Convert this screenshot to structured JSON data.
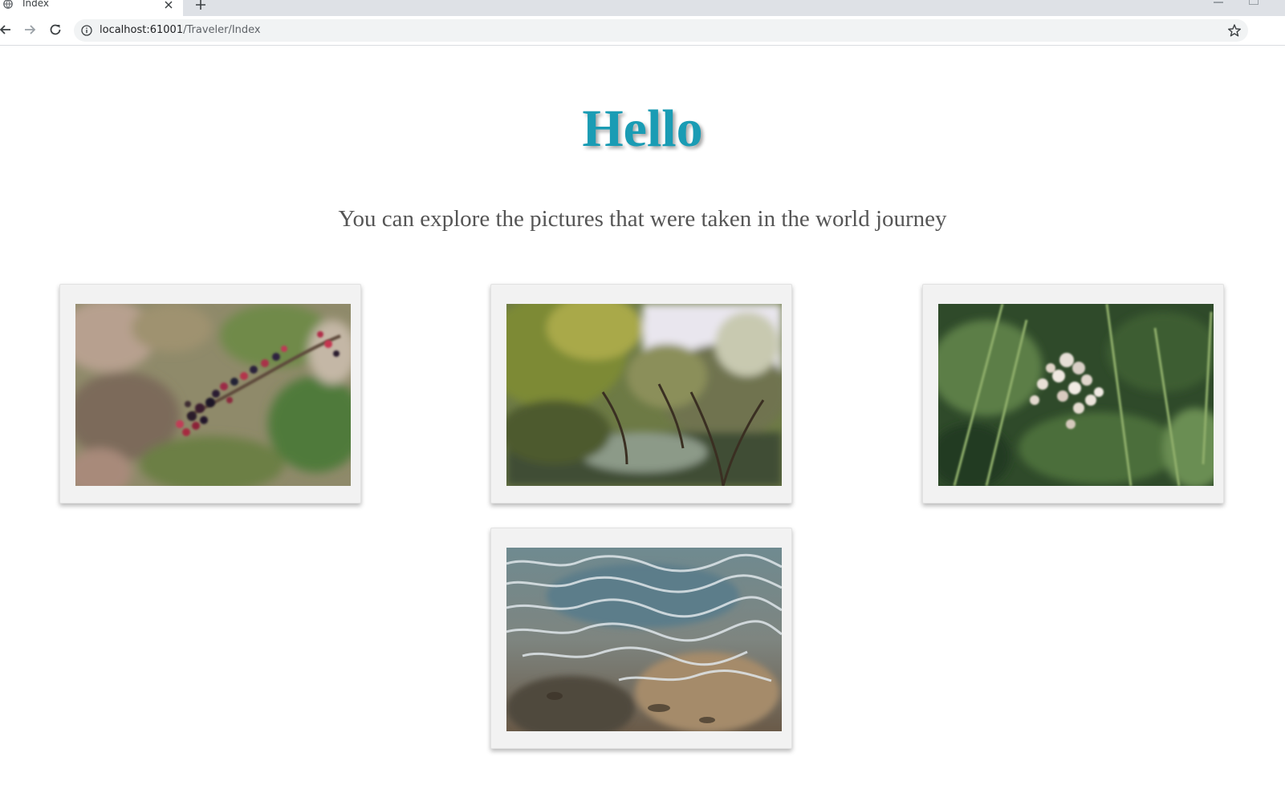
{
  "browser": {
    "tab_title": "Index",
    "url_host": "localhost:61001",
    "url_path": "/Traveler/Index"
  },
  "page": {
    "heading": "Hello",
    "subtitle": "You can explore the pictures that were taken in the world journey",
    "heading_color": "#1a9cb4",
    "gallery": [
      {
        "subject": "blackberries-photo"
      },
      {
        "subject": "orchard-trees-photo"
      },
      {
        "subject": "white-wildflowers-photo"
      },
      {
        "subject": "rippling-water-photo"
      }
    ]
  }
}
